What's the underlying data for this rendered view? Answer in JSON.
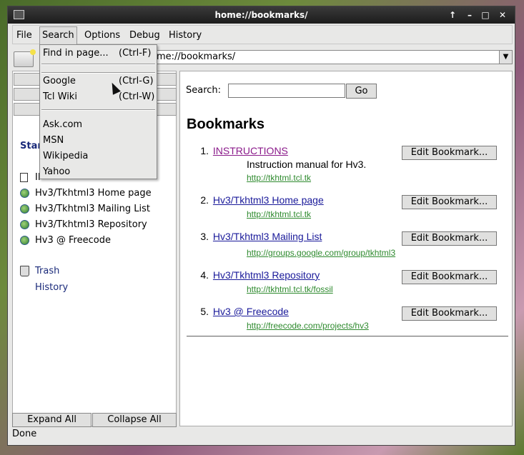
{
  "window": {
    "title": "home://bookmarks/"
  },
  "menu": {
    "file": "File",
    "search": "Search",
    "options": "Options",
    "debug": "Debug",
    "history": "History"
  },
  "url": "home://bookmarks/",
  "search_menu": {
    "items": [
      {
        "label": "Find in page...",
        "accel": "(Ctrl-F)"
      },
      {
        "label": "Google",
        "accel": "(Ctrl-G)"
      },
      {
        "label": "Tcl Wiki",
        "accel": "(Ctrl-W)"
      },
      {
        "label": "Ask.com"
      },
      {
        "label": "MSN"
      },
      {
        "label": "Wikipedia"
      },
      {
        "label": "Yahoo"
      }
    ]
  },
  "tree": {
    "start_label": "Star",
    "items": [
      {
        "label": "II"
      },
      {
        "label": "Hv3/Tkhtml3 Home page"
      },
      {
        "label": "Hv3/Tkhtml3 Mailing List"
      },
      {
        "label": "Hv3/Tkhtml3 Repository"
      },
      {
        "label": "Hv3 @ Freecode"
      }
    ],
    "trash": "Trash",
    "history": "History",
    "expand_all": "Expand All",
    "collapse_all": "Collapse All"
  },
  "content": {
    "search_label": "Search:",
    "search_value": "",
    "go": "Go",
    "heading": "Bookmarks",
    "edit_label": "Edit Bookmark...",
    "bookmarks": [
      {
        "num": "1.",
        "title": "INSTRUCTIONS",
        "desc": "Instruction manual for Hv3.",
        "url": "http://tkhtml.tcl.tk"
      },
      {
        "num": "2.",
        "title": "Hv3/Tkhtml3 Home page",
        "url": "http://tkhtml.tcl.tk"
      },
      {
        "num": "3.",
        "title": "Hv3/Tkhtml3 Mailing List",
        "url": "http://groups.google.com/group/tkhtml3"
      },
      {
        "num": "4.",
        "title": "Hv3/Tkhtml3 Repository",
        "url": "http://tkhtml.tcl.tk/fossil"
      },
      {
        "num": "5.",
        "title": "Hv3 @ Freecode",
        "url": "http://freecode.com/projects/hv3"
      }
    ]
  },
  "status": "Done"
}
